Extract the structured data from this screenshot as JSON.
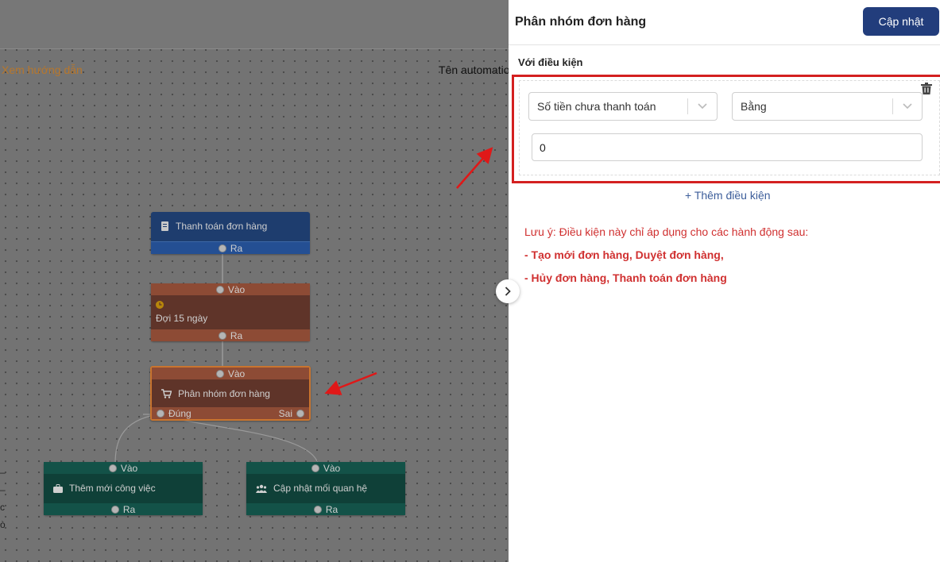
{
  "canvas": {
    "guide_link": "Xem hướng dẫn",
    "automation_name_label": "Tên automation",
    "nodes": {
      "payment": {
        "title": "Thanh toán đơn hàng",
        "out_label": "Ra"
      },
      "wait": {
        "in_label": "Vào",
        "title": "Đợi 15 ngày",
        "out_label": "Ra"
      },
      "classify": {
        "in_label": "Vào",
        "title": "Phân nhóm đơn hàng",
        "true_label": "Đúng",
        "false_label": "Sai"
      },
      "add_task": {
        "in_label": "Vào",
        "title": "Thêm mới công việc",
        "out_label": "Ra"
      },
      "update_relation": {
        "in_label": "Vào",
        "title": "Cập nhật mối quan hệ",
        "out_label": "Ra"
      }
    },
    "left_edge_chars": [
      "–",
      "–",
      "c",
      "ò"
    ]
  },
  "panel": {
    "title": "Phân nhóm đơn hàng",
    "update_button": "Cập nhật",
    "condition_label": "Với điều kiện",
    "condition": {
      "field": "Số tiền chưa thanh toán",
      "operator": "Bằng",
      "value": "0"
    },
    "add_condition": "+ Thêm điều kiện",
    "note_intro": "Lưu ý: Điều kiện này chỉ áp dụng cho các hành động sau:",
    "note_lines": [
      "- Tạo mới đơn hàng, Duyệt đơn hàng,",
      "- Hủy đơn hàng, Thanh toán đơn hàng"
    ]
  },
  "colors": {
    "primary": "#223d7c",
    "highlight_border": "#d42020",
    "note_text": "#d03030",
    "guide_link": "#b8772b"
  },
  "icons": [
    "receipt-icon",
    "clock-icon",
    "cart-icon",
    "briefcase-icon",
    "users-icon",
    "trash-icon",
    "chevron-down-icon",
    "chevron-right-icon"
  ]
}
